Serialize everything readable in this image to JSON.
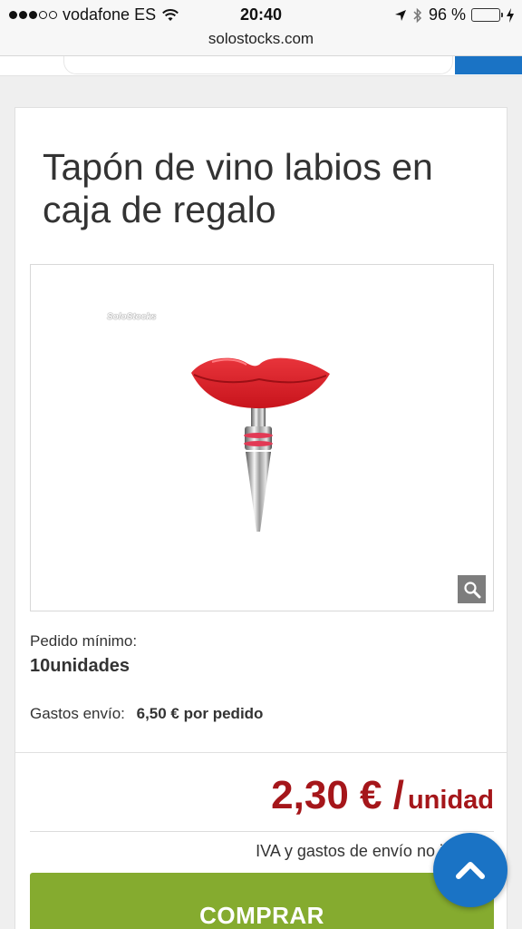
{
  "status_bar": {
    "carrier": "vodafone ES",
    "time": "20:40",
    "battery": "96 %",
    "battery_level": 0.96
  },
  "browser": {
    "url": "solostocks.com"
  },
  "product": {
    "title": "Tapón de vino labios en caja de regalo",
    "watermark": "SoloStocks",
    "min_order_label": "Pedido mínimo:",
    "min_order_value": "10unidades",
    "shipping_label": "Gastos envío:",
    "shipping_value": "6,50 € por pedido"
  },
  "pricing": {
    "amount": "2,30 € /",
    "unit": "unidad",
    "vat_note": "IVA y gastos de envío no ind",
    "buy_label": "COMPRAR"
  },
  "colors": {
    "accent_blue": "#1a73c5",
    "price_red": "#a5161a",
    "buy_green": "#85ab2f"
  },
  "icons": [
    "signal-dots",
    "wifi-icon",
    "location-arrow-icon",
    "bluetooth-icon",
    "battery-icon",
    "charging-bolt-icon",
    "zoom-icon",
    "chevron-up-icon"
  ]
}
